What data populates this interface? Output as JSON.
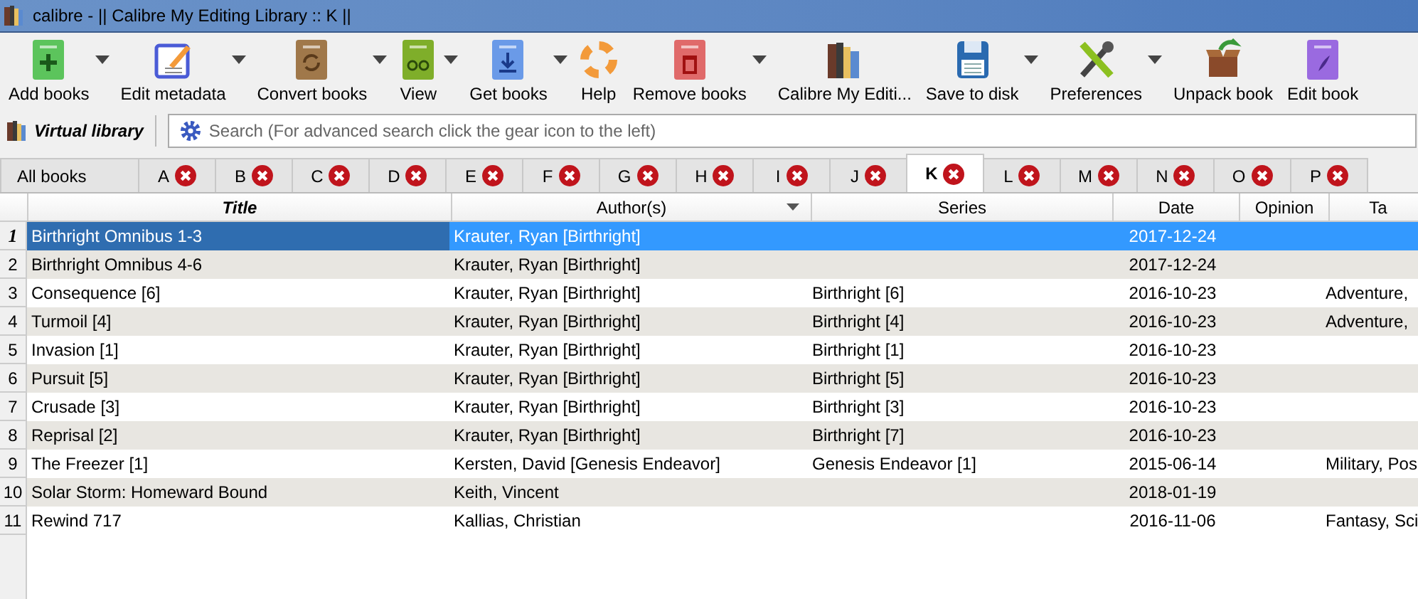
{
  "window": {
    "title": "calibre - || Calibre My Editing Library :: K ||"
  },
  "toolbar": [
    {
      "label": "Add books",
      "dropdown": true
    },
    {
      "label": "Edit metadata",
      "dropdown": true
    },
    {
      "label": "Convert books",
      "dropdown": true
    },
    {
      "label": "View",
      "dropdown": true
    },
    {
      "label": "Get books",
      "dropdown": true
    },
    {
      "label": "Help",
      "dropdown": false
    },
    {
      "label": "Remove books",
      "dropdown": true
    },
    {
      "label": "Calibre My Editi...",
      "dropdown": false
    },
    {
      "label": "Save to disk",
      "dropdown": true
    },
    {
      "label": "Preferences",
      "dropdown": true
    },
    {
      "label": "Unpack book",
      "dropdown": false
    },
    {
      "label": "Edit book",
      "dropdown": false
    }
  ],
  "virtual_library": {
    "label": "Virtual library"
  },
  "search": {
    "placeholder": "Search (For advanced search click the gear icon to the left)"
  },
  "tabs": [
    {
      "label": "All books",
      "closable": false,
      "selected": false
    },
    {
      "label": "A",
      "closable": true,
      "selected": false
    },
    {
      "label": "B",
      "closable": true,
      "selected": false
    },
    {
      "label": "C",
      "closable": true,
      "selected": false
    },
    {
      "label": "D",
      "closable": true,
      "selected": false
    },
    {
      "label": "E",
      "closable": true,
      "selected": false
    },
    {
      "label": "F",
      "closable": true,
      "selected": false
    },
    {
      "label": "G",
      "closable": true,
      "selected": false
    },
    {
      "label": "H",
      "closable": true,
      "selected": false
    },
    {
      "label": "I",
      "closable": true,
      "selected": false
    },
    {
      "label": "J",
      "closable": true,
      "selected": false
    },
    {
      "label": "K",
      "closable": true,
      "selected": true
    },
    {
      "label": "L",
      "closable": true,
      "selected": false
    },
    {
      "label": "M",
      "closable": true,
      "selected": false
    },
    {
      "label": "N",
      "closable": true,
      "selected": false
    },
    {
      "label": "O",
      "closable": true,
      "selected": false
    },
    {
      "label": "P",
      "closable": true,
      "selected": false
    }
  ],
  "table": {
    "columns": [
      {
        "label": "Title",
        "current": true,
        "sorted": false
      },
      {
        "label": "Author(s)",
        "current": false,
        "sorted": true
      },
      {
        "label": "Series",
        "current": false,
        "sorted": false
      },
      {
        "label": "Date",
        "current": false,
        "sorted": false
      },
      {
        "label": "Opinion",
        "current": false,
        "sorted": false
      },
      {
        "label": "Ta",
        "current": false,
        "sorted": false
      }
    ],
    "rows": [
      {
        "number": "1",
        "selected": true,
        "cells": [
          "Birthright Omnibus 1-3",
          "Krauter, Ryan [Birthright]",
          "",
          "2017-12-24",
          "",
          ""
        ]
      },
      {
        "number": "2",
        "selected": false,
        "cells": [
          "Birthright Omnibus 4-6",
          "Krauter, Ryan [Birthright]",
          "",
          "2017-12-24",
          "",
          ""
        ]
      },
      {
        "number": "3",
        "selected": false,
        "cells": [
          "Consequence [6]",
          "Krauter, Ryan [Birthright]",
          "Birthright [6]",
          "2016-10-23",
          "",
          "Adventure,"
        ]
      },
      {
        "number": "4",
        "selected": false,
        "cells": [
          "Turmoil [4]",
          "Krauter, Ryan [Birthright]",
          "Birthright [4]",
          "2016-10-23",
          "",
          "Adventure,"
        ]
      },
      {
        "number": "5",
        "selected": false,
        "cells": [
          "Invasion [1]",
          "Krauter, Ryan [Birthright]",
          "Birthright [1]",
          "2016-10-23",
          "",
          ""
        ]
      },
      {
        "number": "6",
        "selected": false,
        "cells": [
          "Pursuit [5]",
          "Krauter, Ryan [Birthright]",
          "Birthright [5]",
          "2016-10-23",
          "",
          ""
        ]
      },
      {
        "number": "7",
        "selected": false,
        "cells": [
          "Crusade [3]",
          "Krauter, Ryan [Birthright]",
          "Birthright [3]",
          "2016-10-23",
          "",
          ""
        ]
      },
      {
        "number": "8",
        "selected": false,
        "cells": [
          "Reprisal [2]",
          "Krauter, Ryan [Birthright]",
          "Birthright [7]",
          "2016-10-23",
          "",
          ""
        ]
      },
      {
        "number": "9",
        "selected": false,
        "cells": [
          "The Freezer [1]",
          "Kersten, David [Genesis Endeavor]",
          "Genesis Endeavor [1]",
          "2015-06-14",
          "",
          "Military, Pos"
        ]
      },
      {
        "number": "10",
        "selected": false,
        "cells": [
          "Solar Storm: Homeward Bound",
          "Keith, Vincent",
          "",
          "2018-01-19",
          "",
          ""
        ]
      },
      {
        "number": "11",
        "selected": false,
        "cells": [
          "Rewind 717",
          "Kallias, Christian",
          "",
          "2016-11-06",
          "",
          "Fantasy, Sci"
        ]
      }
    ]
  }
}
